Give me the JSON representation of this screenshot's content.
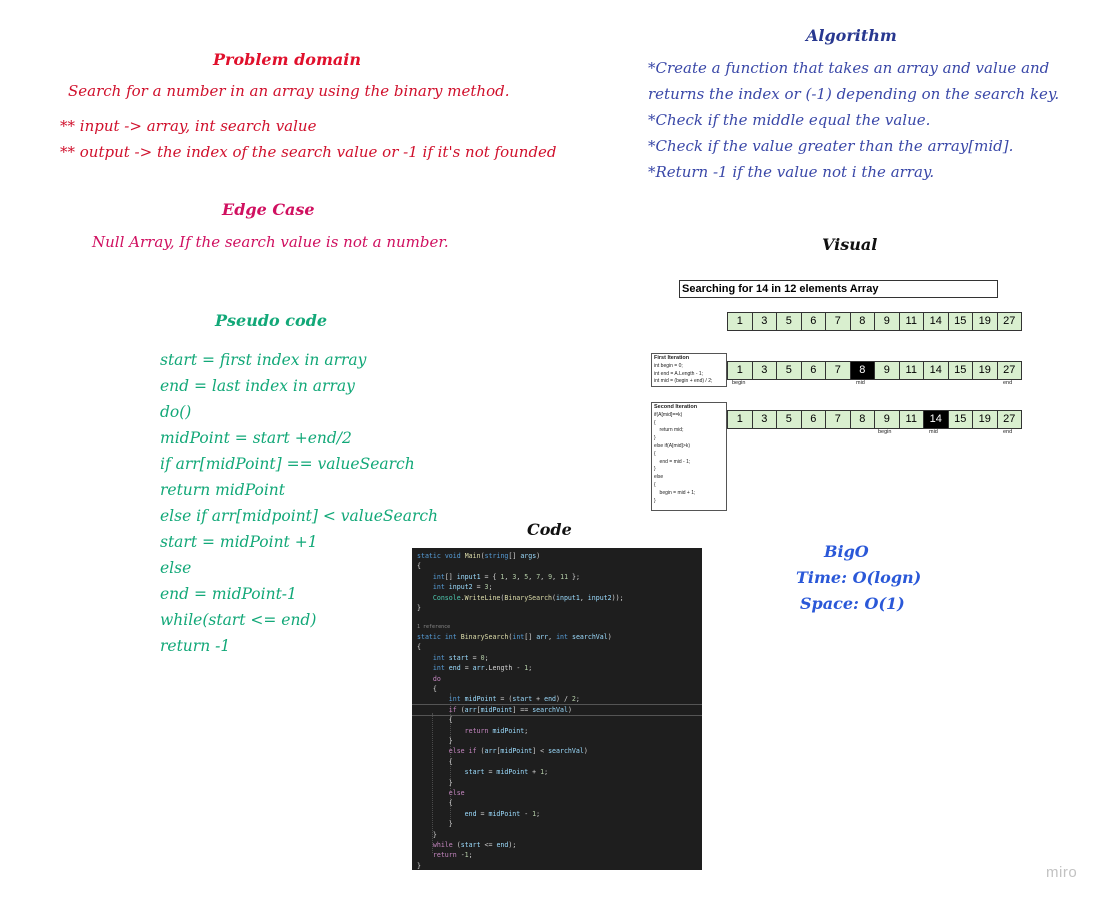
{
  "problem_domain": {
    "heading": "Problem domain",
    "description": "Search for a number in an array using the binary method.",
    "input": "** input -> array, int search value",
    "output": "** output -> the index of the search value or -1 if it's not founded"
  },
  "edge_case": {
    "heading": "Edge Case",
    "text": "Null Array, If the search value is not a number."
  },
  "pseudo_code": {
    "heading": "Pseudo code",
    "lines": [
      "start = first index in array",
      "end = last index in array",
      "do()",
      "midPoint = start +end/2",
      "if arr[midPoint] == valueSearch",
      "return midPoint",
      "else if arr[midpoint] < valueSearch",
      "start = midPoint +1",
      "else",
      "end = midPoint-1",
      "while(start <= end)",
      "return -1"
    ]
  },
  "algorithm": {
    "heading": "Algorithm",
    "lines": [
      "*Create a function that takes an array and value and",
      "returns the index or (-1) depending on the search key.",
      "*Check if the middle equal the value.",
      "*Check if the value greater than the array[mid].",
      "*Return -1 if the value not i the array."
    ]
  },
  "visual": {
    "heading": "Visual",
    "title": "Searching for 14 in 12 elements Array",
    "array": [
      "1",
      "3",
      "5",
      "6",
      "7",
      "8",
      "9",
      "11",
      "14",
      "15",
      "19",
      "27"
    ],
    "iterations": [
      {
        "title": "First Iteration",
        "notes": [
          "int begin = 0;",
          "int end = A.Length - 1;",
          "int mid = (begin + end) / 2;"
        ],
        "highlight_index": 5,
        "labels": {
          "begin": "begin",
          "mid": "mid",
          "end": "end"
        }
      },
      {
        "title": "Second Iteration",
        "notes": [
          "if(A[mid]==k)",
          "{",
          "    return mid;",
          "}",
          "else if(A[mid]>k)",
          "{",
          "    end = mid - 1;",
          "}",
          "else",
          "{",
          "    begin = mid + 1;",
          "}"
        ],
        "highlight_index": 8,
        "labels": {
          "begin": "begin",
          "mid": "mid",
          "end": "end"
        }
      }
    ]
  },
  "code_section": {
    "heading": "Code",
    "reference": "1 reference"
  },
  "bigo": {
    "heading": "BigO",
    "time": "Time: O(logn)",
    "space": "Space: O(1)"
  },
  "watermark": "miro",
  "colors": {
    "problem": "#e0102c",
    "edge": "#d01060",
    "pseudo": "#12a878",
    "algorithm": "#3a48a8",
    "highlight": "#000000",
    "cell_fill": "#d9efcf",
    "code_bg": "#1e1e1e"
  }
}
